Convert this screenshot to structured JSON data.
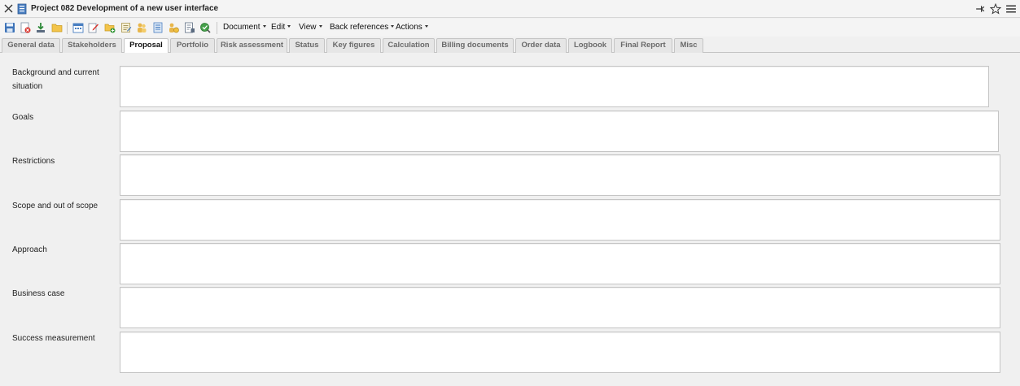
{
  "window": {
    "title": "Project 082 Development of a new user interface"
  },
  "toolbar": {
    "icons": [
      "save-icon",
      "delete-icon",
      "download-icon",
      "folder-icon",
      "calendar-icon",
      "edit-icon",
      "add-folder-icon",
      "note-icon",
      "people-icon",
      "list-icon",
      "coins-icon",
      "report-icon",
      "search-check-icon"
    ],
    "menus": [
      "Document",
      "Edit",
      "View",
      "Back references",
      "Actions"
    ]
  },
  "tabs": [
    {
      "label": "General data"
    },
    {
      "label": "Stakeholders"
    },
    {
      "label": "Proposal"
    },
    {
      "label": "Portfolio"
    },
    {
      "label": "Risk assessment"
    },
    {
      "label": "Status"
    },
    {
      "label": "Key figures"
    },
    {
      "label": "Calculation"
    },
    {
      "label": "Billing documents"
    },
    {
      "label": "Order data"
    },
    {
      "label": "Logbook"
    },
    {
      "label": "Final Report"
    },
    {
      "label": "Misc"
    }
  ],
  "active_tab": "Proposal",
  "form": {
    "fields": [
      {
        "label": "Background and current situation",
        "value": ""
      },
      {
        "label": "Goals",
        "value": ""
      },
      {
        "label": "Restrictions",
        "value": ""
      },
      {
        "label": "Scope and out of scope",
        "value": ""
      },
      {
        "label": "Approach",
        "value": ""
      },
      {
        "label": "Business case",
        "value": ""
      },
      {
        "label": "Success measurement",
        "value": ""
      }
    ]
  },
  "colors": {
    "background": "#f0f0f0",
    "active_tab": "#ffffff",
    "inactive_tab": "#e6e6e6",
    "border": "#c4c4c4"
  }
}
